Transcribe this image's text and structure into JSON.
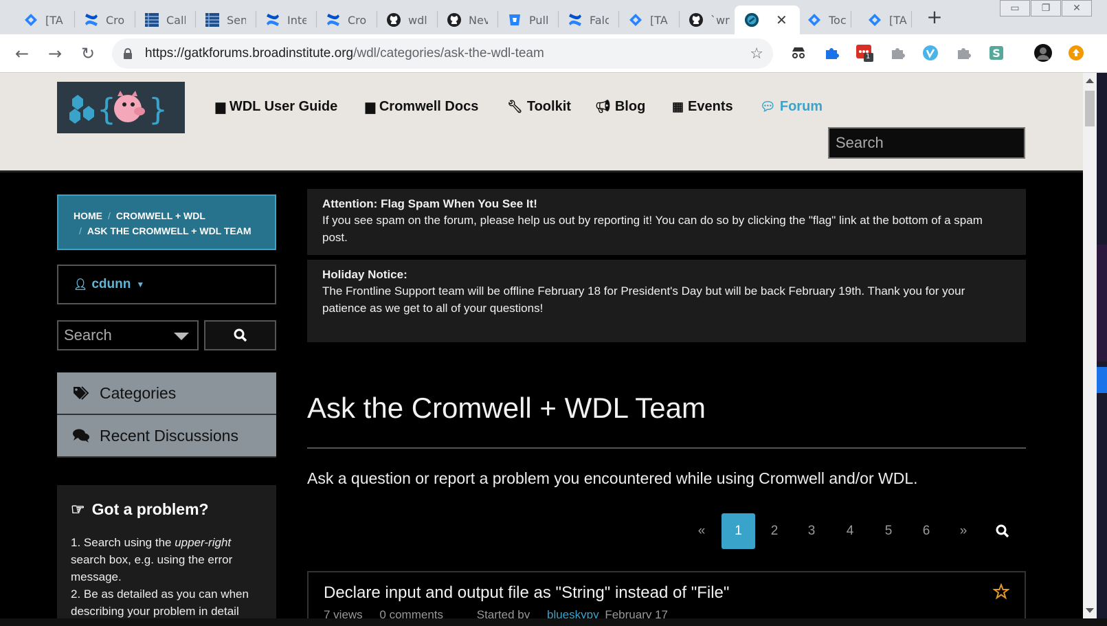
{
  "browser": {
    "tabs": [
      {
        "title": "[TA",
        "icon": "jira-icon"
      },
      {
        "title": "Cro",
        "icon": "confluence-icon"
      },
      {
        "title": "Call",
        "icon": "document-icon"
      },
      {
        "title": "Sen",
        "icon": "document-icon"
      },
      {
        "title": "Inte",
        "icon": "confluence-icon"
      },
      {
        "title": "Cro",
        "icon": "confluence-icon"
      },
      {
        "title": "wdl",
        "icon": "github-icon"
      },
      {
        "title": "Nev",
        "icon": "github-icon"
      },
      {
        "title": "Pull",
        "icon": "bitbucket-icon"
      },
      {
        "title": "Falc",
        "icon": "confluence-icon"
      },
      {
        "title": "[TA",
        "icon": "jira-icon"
      },
      {
        "title": "`wri",
        "icon": "github-icon"
      },
      {
        "title": "",
        "icon": "forum-icon",
        "active": true
      },
      {
        "title": "Toc",
        "icon": "jira-icon"
      },
      {
        "title": "[TA",
        "icon": "jira-icon"
      }
    ],
    "url_domain": "https://gatkforums.broadinstitute.org",
    "url_path": "/wdl/categories/ask-the-wdl-team",
    "extension_badge": "1"
  },
  "header": {
    "nav": [
      {
        "label": "WDL User Guide",
        "icon": "book-icon"
      },
      {
        "label": "Cromwell Docs",
        "icon": "book-icon"
      },
      {
        "label": "Toolkit",
        "icon": "wrench-icon"
      },
      {
        "label": "Blog",
        "icon": "bullhorn-icon"
      },
      {
        "label": "Events",
        "icon": "calendar-icon"
      },
      {
        "label": "Forum",
        "icon": "comments-icon",
        "active": true
      }
    ],
    "search_placeholder": "Search"
  },
  "sidebar": {
    "breadcrumb": {
      "home": "HOME",
      "parent": "CROMWELL + WDL",
      "current": "ASK THE CROMWELL + WDL TEAM"
    },
    "user": "cdunn",
    "search_placeholder": "Search",
    "categories_label": "Categories",
    "recent_label": "Recent Discussions",
    "problem_title": "Got a problem?",
    "problem_step1_a": "1. Search using the ",
    "problem_step1_em": "upper-right",
    "problem_step1_b": " search box, e.g. using the error message.",
    "problem_step2": "2. Be as detailed as you can when describing your problem in detail"
  },
  "notices": [
    {
      "title": "Attention: Flag Spam When You See It!",
      "body": "If you see spam on the forum, please help us out by reporting it! You can do so by clicking the \"flag\" link at the bottom of a spam post."
    },
    {
      "title": "Holiday Notice:",
      "body": "The Frontline Support team will be offline February 18 for President's Day but will be back February 19th. Thank you for your patience as we get to all of your questions!"
    }
  ],
  "category": {
    "title": "Ask the Cromwell + WDL Team",
    "description": "Ask a question or report a problem you encountered while using Cromwell and/or WDL."
  },
  "pager": {
    "prev": "«",
    "pages": [
      "1",
      "2",
      "3",
      "4",
      "5",
      "6"
    ],
    "current": "1",
    "next": "»"
  },
  "discussions": [
    {
      "title": "Declare input and output file as \"String\" instead of \"File\"",
      "views": "7 views",
      "comments": "0 comments",
      "started_by": "Started by",
      "author": "blueskypy",
      "date": "February 17"
    }
  ],
  "colors": {
    "accent": "#3aa3c9",
    "breadcrumb_bg": "#27728c",
    "page_bg": "#000000",
    "header_bg": "#e9e6e2"
  }
}
